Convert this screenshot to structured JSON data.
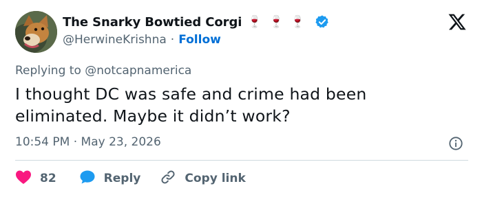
{
  "author": {
    "display_name": "The Snarky Bowtied Corgi",
    "name_emojis": [
      "🍷",
      "🍷",
      "🍷"
    ],
    "verified_icon": "verified-badge-icon",
    "handle": "@HerwineKrishna",
    "separator": "·",
    "follow_label": "Follow"
  },
  "brand": {
    "icon": "x-logo-icon"
  },
  "tweet": {
    "replying_to": "Replying to @notcapnamerica",
    "text": "I thought DC was safe and crime had been eliminated. Maybe it didn’t work?",
    "time": "10:54 PM",
    "separator": "·",
    "date": "May 23, 2026"
  },
  "actions": {
    "like_count": "82",
    "reply_label": "Reply",
    "copy_label": "Copy link"
  },
  "colors": {
    "accent": "#1d9bf0",
    "follow": "#006fd6",
    "like": "#f91880",
    "muted": "#536471",
    "text": "#0f1419"
  }
}
